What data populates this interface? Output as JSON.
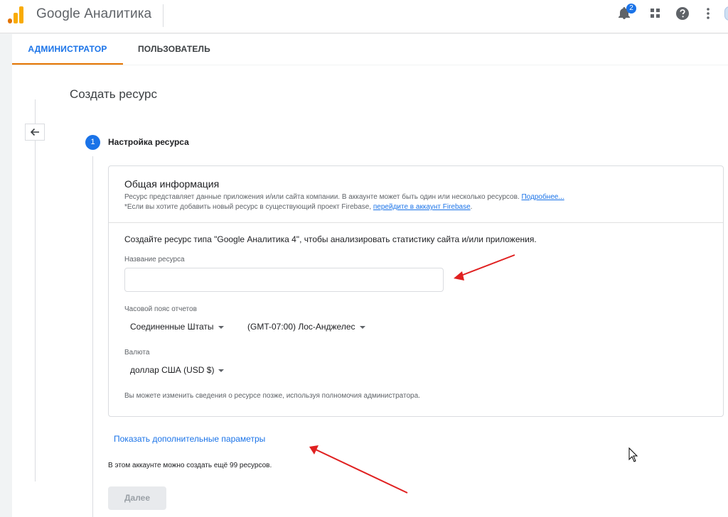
{
  "header": {
    "brand": "Google Аналитика",
    "notification_count": "2",
    "icons": [
      "analytics-logo-icon",
      "bell-icon",
      "apps-grid-icon",
      "help-icon",
      "more-vert-icon"
    ]
  },
  "tabs": [
    {
      "label": "АДМИНИСТРАТОР",
      "active": true
    },
    {
      "label": "ПОЛЬЗОВАТЕЛЬ",
      "active": false
    }
  ],
  "page": {
    "title": "Создать ресурс",
    "step_number": "1",
    "step_title": "Настройка ресурса"
  },
  "card": {
    "heading": "Общая информация",
    "line1": "Ресурс представляет данные приложения и/или сайта компании. В аккаунте может быть один или несколько ресурсов.",
    "line1_link": "Подробнее...",
    "line2": "*Если вы хотите добавить новый ресурс в существующий проект Firebase,",
    "line2_link": "перейдите в аккаунт Firebase",
    "line2_end": ".",
    "intro": "Создайте ресурс типа \"Google Аналитика 4\", чтобы анализировать статистику сайта и/или приложения.",
    "name_label": "Название ресурса",
    "name_value": "",
    "timezone_label": "Часовой пояс отчетов",
    "country": "Соединенные Штаты",
    "timezone": "(GMT-07:00) Лос-Анджелес",
    "currency_label": "Валюта",
    "currency": "доллар США (USD $)",
    "note": "Вы можете изменить сведения о ресурсе позже, используя полномочия администратора."
  },
  "footer": {
    "more_params": "Показать дополнительные параметры",
    "count_text": "В этом аккаунте можно создать ещё 99 ресурсов.",
    "next_label": "Далее"
  },
  "colors": {
    "accent": "#1a73e8",
    "tab_underline": "#e37400",
    "annotation_arrow": "#e02020",
    "logo_orange": "#f9ab00",
    "logo_dark_orange": "#e37400"
  }
}
